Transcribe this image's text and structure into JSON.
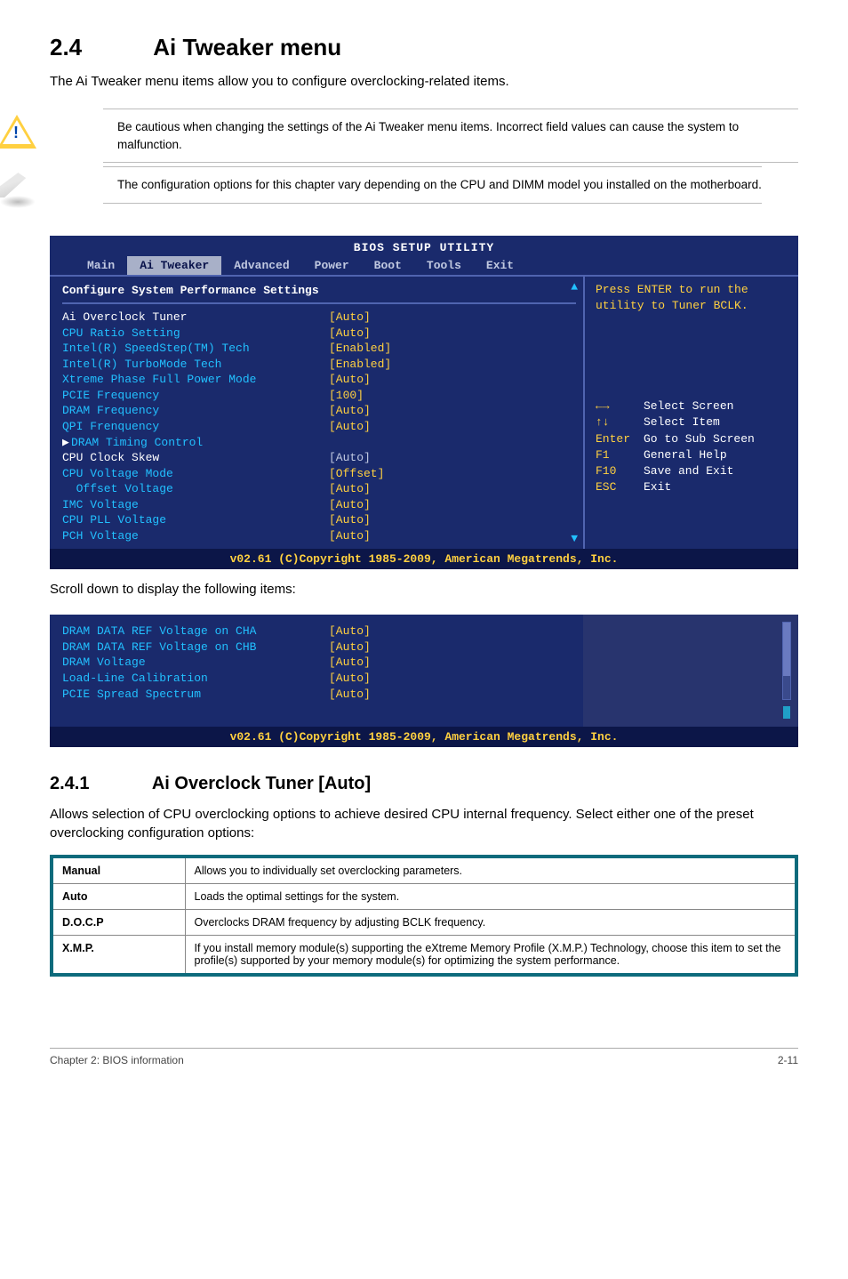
{
  "section": {
    "number": "2.4",
    "title": "Ai Tweaker menu"
  },
  "lead": "The Ai Tweaker menu items allow you to configure overclocking-related items.",
  "callouts": {
    "warn": "Be cautious when changing the settings of the Ai Tweaker menu items. Incorrect field values can cause the system to malfunction.",
    "note": "The configuration options for this chapter vary depending on the CPU and DIMM model you installed on the motherboard."
  },
  "bios1": {
    "title": "BIOS SETUP UTILITY",
    "tabs": [
      "Main",
      "Ai Tweaker",
      "Advanced",
      "Power",
      "Boot",
      "Tools",
      "Exit"
    ],
    "active_tab_index": 1,
    "config_header": "Configure System Performance Settings",
    "rows": [
      {
        "lbl": "Ai Overclock Tuner",
        "val": "[Auto]",
        "lblClass": "white"
      },
      {
        "lbl": "CPU Ratio Setting",
        "val": "[Auto]"
      },
      {
        "lbl": "Intel(R) SpeedStep(TM) Tech",
        "val": "[Enabled]"
      },
      {
        "lbl": "Intel(R) TurboMode Tech",
        "val": "[Enabled]"
      },
      {
        "lbl": "Xtreme Phase Full Power Mode",
        "val": "[Auto]"
      },
      {
        "lbl": "PCIE Frequency",
        "val": "[100]"
      },
      {
        "lbl": "DRAM Frequency",
        "val": "[Auto]"
      },
      {
        "lbl": "QPI Frenquency",
        "val": "[Auto]"
      },
      {
        "lbl": "",
        "val": ""
      },
      {
        "lbl": "DRAM Timing Control",
        "val": "",
        "marker": "▶"
      },
      {
        "lbl": "CPU Clock Skew",
        "val": "[Auto]",
        "lblClass": "white",
        "valClass": "grey"
      },
      {
        "lbl": "",
        "val": ""
      },
      {
        "lbl": "CPU Voltage Mode",
        "val": "[Offset]"
      },
      {
        "lbl": "  Offset Voltage",
        "val": "[Auto]"
      },
      {
        "lbl": "IMC Voltage",
        "val": "[Auto]"
      },
      {
        "lbl": "CPU PLL Voltage",
        "val": "[Auto]"
      },
      {
        "lbl": "PCH Voltage",
        "val": "[Auto]"
      }
    ],
    "help_top": "Press ENTER to run the\nutility to Tuner BCLK.",
    "nav": [
      {
        "k": "←→",
        "t": "Select Screen"
      },
      {
        "k": "↑↓",
        "t": "Select Item"
      },
      {
        "k": "Enter",
        "t": "Go to Sub Screen"
      },
      {
        "k": "F1",
        "t": "General Help"
      },
      {
        "k": "F10",
        "t": "Save and Exit"
      },
      {
        "k": "ESC",
        "t": "Exit"
      }
    ],
    "footer": "v02.61 (C)Copyright 1985-2009, American Megatrends, Inc."
  },
  "scroll_note": "Scroll down to display the following items:",
  "bios2": {
    "rows": [
      {
        "lbl": "DRAM DATA REF Voltage on CHA",
        "val": "[Auto]"
      },
      {
        "lbl": "DRAM DATA REF Voltage on CHB",
        "val": "[Auto]"
      },
      {
        "lbl": "DRAM Voltage",
        "val": "[Auto]"
      },
      {
        "lbl": "",
        "val": ""
      },
      {
        "lbl": "Load-Line Calibration",
        "val": "[Auto]"
      },
      {
        "lbl": "PCIE Spread Spectrum",
        "val": "[Auto]"
      }
    ],
    "footer": "v02.61 (C)Copyright 1985-2009, American Megatrends, Inc."
  },
  "subsection": {
    "number": "2.4.1",
    "title": "Ai Overclock Tuner [Auto]"
  },
  "sub_lead": "Allows selection of CPU overclocking options to achieve desired CPU internal frequency. Select either one of the preset overclocking configuration options:",
  "opts": [
    {
      "k": "Manual",
      "v": "Allows you to individually set overclocking parameters."
    },
    {
      "k": "Auto",
      "v": "Loads the optimal settings for the system."
    },
    {
      "k": "D.O.C.P",
      "v": "Overclocks DRAM frequency by adjusting BCLK frequency."
    },
    {
      "k": "X.M.P.",
      "v": "If you install memory module(s) supporting the eXtreme Memory Profile (X.M.P.) Technology, choose this item to set the profile(s) supported by your memory module(s) for optimizing the system performance."
    }
  ],
  "footer": {
    "left": "Chapter 2: BIOS information",
    "right": "2-11"
  }
}
